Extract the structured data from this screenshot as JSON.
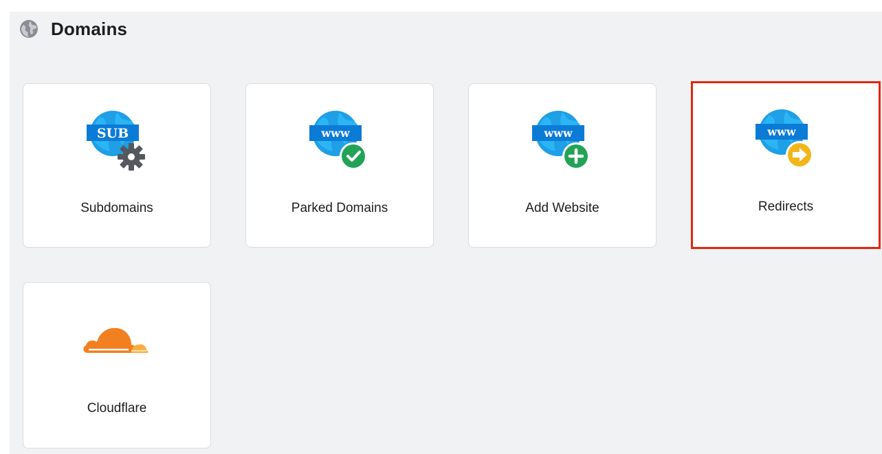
{
  "header": {
    "title": "Domains",
    "icon": "globe-icon"
  },
  "tiles": [
    {
      "label": "Subdomains",
      "icon": "subdomain-globe-gear-icon"
    },
    {
      "label": "Parked Domains",
      "icon": "www-globe-check-icon"
    },
    {
      "label": "Add Website",
      "icon": "www-globe-plus-icon"
    },
    {
      "label": "Redirects",
      "icon": "www-globe-arrow-icon",
      "selected": true
    },
    {
      "label": "Cloudflare",
      "icon": "cloudflare-cloud-icon"
    }
  ],
  "icon_text": {
    "sub": "SUB",
    "www": "www"
  },
  "colors": {
    "globe_blue": "#1e9fe6",
    "banner_blue": "#0b7bd6",
    "check_green": "#22a356",
    "arrow_yellow": "#f2b61a",
    "gear_gray": "#55595e",
    "cloudflare_orange": "#f38020",
    "cloudflare_light": "#faad3f",
    "selection_red": "#e3260d"
  }
}
